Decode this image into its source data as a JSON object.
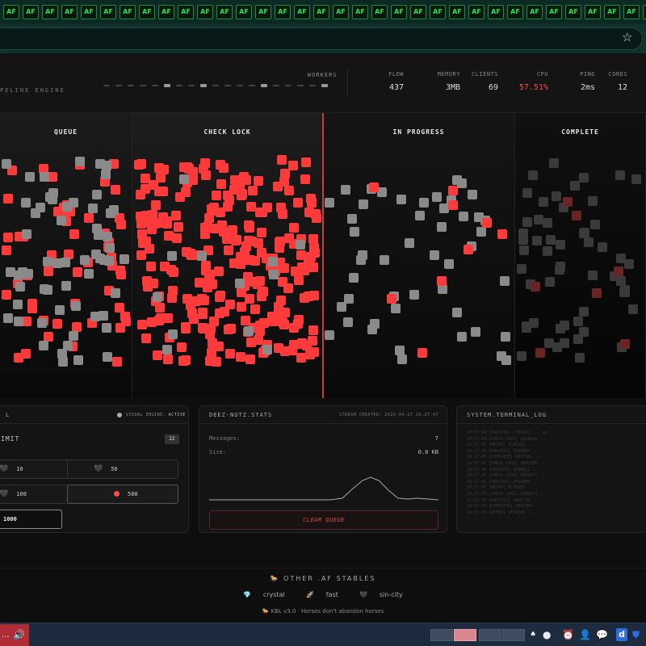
{
  "browser": {
    "tab_label": "AF",
    "tab_count": 39,
    "star_icon": "star-icon"
  },
  "topbar": {
    "engine_label": "PELINE ENGINE",
    "workers_label": "WORKERS",
    "metrics": [
      {
        "label": "FLOW",
        "value": "437",
        "color": "#dddddd"
      },
      {
        "label": "MEMORY",
        "value": "3MB",
        "color": "#dddddd"
      },
      {
        "label": "CLIENTS",
        "value": "69",
        "color": "#dddddd"
      },
      {
        "label": "CPU",
        "value": "57.51%",
        "color": "#ff4a4a"
      },
      {
        "label": "PING",
        "value": "2ms",
        "color": "#dddddd"
      },
      {
        "label": "CORES",
        "value": "12",
        "color": "#dddddd"
      }
    ]
  },
  "board": {
    "columns": [
      {
        "id": "queue",
        "title": "QUEUE"
      },
      {
        "id": "check",
        "title": "CHECK LOCK"
      },
      {
        "id": "progress",
        "title": "IN PROGRESS"
      },
      {
        "id": "complete",
        "title": "COMPLETE"
      }
    ],
    "colors": {
      "locked": "#ff3a3a",
      "pending": "#8a8a8a",
      "faded": "#3a3a3a",
      "faded_red": "#6a2424"
    }
  },
  "rate_panel": {
    "title": "L",
    "status_label": "VISUAL ENGINE:",
    "status_value": "ACTIVE",
    "limit_label": "IMIT",
    "limit_count": "22",
    "options": [
      {
        "label": "10",
        "icon": "heart-icon"
      },
      {
        "label": "50",
        "icon": "heart-icon"
      },
      {
        "label": "100",
        "icon": "heart-icon"
      },
      {
        "label": "500",
        "icon": "red-dot-icon"
      },
      {
        "label": "1000",
        "icon": "none"
      }
    ]
  },
  "stats_panel": {
    "title": "DEEZ-NUTZ.STATS",
    "created": "STREAM CREATED: 2026-04-27 20:37:47",
    "messages_label": "Messages:",
    "messages_value": "7",
    "size_label": "Size:",
    "size_value": "0.8 KB",
    "clear_label": "CLEAR QUEUE"
  },
  "log_panel": {
    "title": "SYSTEM.TERMINAL_LOG",
    "lines": [
      "20:37:44 [PROCESS] 7791A01 ... ok",
      "20:37:44 [CHECK_LOCK] 1A59B2D ...",
      "20:37:45 [RETRY] 5C3D2A1 ...",
      "20:37:45 [PROCESS] 7D2E8F4 ...",
      "20:37:45 [COMPLETE] 9E1F3A2 ...",
      "20:37:46 [CHECK_LOCK] 3B4C5D6 ...",
      "20:37:46 [PROCESS] 8A9B0C1 ...",
      "20:37:46 [CHECK_LOCK] 4D5E6F7 ...",
      "20:37:46 [PROCESS] 2F3A4B5 ...",
      "20:37:47 [RETRY] 6C7D8E9 ...",
      "20:37:47 [CHECK_LOCK] 0A1B2C3 ...",
      "20:37:47 [PROCESS] 5E6F7A8 ...",
      "20:37:47 [COMPLETE] 1B2C3D4 ...",
      "20:37:47 [RETRY] 9F0A1B2 ..."
    ]
  },
  "footer": {
    "stables_title": "OTHER .AF STABLES",
    "links": [
      {
        "icon": "💎",
        "label": "crystal"
      },
      {
        "icon": "🚀",
        "label": "fast"
      },
      {
        "icon": "🖤",
        "label": "sin-city"
      }
    ],
    "note_icon": "🐎",
    "note": "KBL v3.0 · Horses don't abandon horses"
  },
  "taskbar": {
    "active_label": "...",
    "speaker_icon": "speaker-icon"
  }
}
